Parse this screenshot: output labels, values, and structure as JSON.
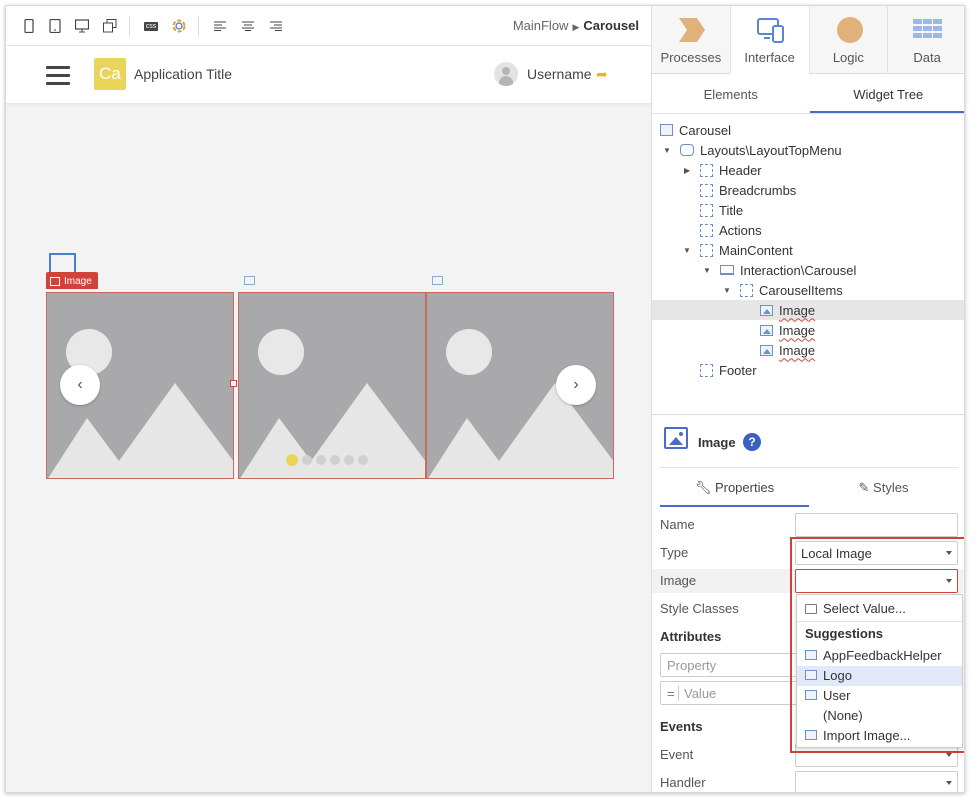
{
  "toolbar": {
    "breadcrumb_flow": "MainFlow",
    "breadcrumb_screen": "Carousel",
    "icons": [
      "phone-icon",
      "tablet-icon",
      "desktop-icon",
      "multi-device-icon",
      "css-icon",
      "theme-icon",
      "align-left-icon",
      "align-center-icon",
      "align-right-icon"
    ],
    "css_label": "css"
  },
  "app_header": {
    "logo_text": "Ca",
    "title": "Application Title",
    "username": "Username"
  },
  "canvas": {
    "image_tag": "Image",
    "carousel_slides": 3,
    "dots_count": 6,
    "active_dot": 1
  },
  "panel": {
    "top_tabs": [
      {
        "label": "Processes"
      },
      {
        "label": "Interface"
      },
      {
        "label": "Logic"
      },
      {
        "label": "Data"
      }
    ],
    "sub_tabs": [
      {
        "label": "Elements"
      },
      {
        "label": "Widget Tree"
      }
    ],
    "tree": [
      {
        "label": "Carousel"
      },
      {
        "label": "Layouts\\LayoutTopMenu"
      },
      {
        "label": "Header"
      },
      {
        "label": "Breadcrumbs"
      },
      {
        "label": "Title"
      },
      {
        "label": "Actions"
      },
      {
        "label": "MainContent"
      },
      {
        "label": "Interaction\\Carousel"
      },
      {
        "label": "CarouselItems"
      },
      {
        "label": "Image"
      },
      {
        "label": "Image"
      },
      {
        "label": "Image"
      },
      {
        "label": "Footer"
      }
    ],
    "properties": {
      "title": "Image",
      "help": "?",
      "tabs": [
        {
          "label": "Properties"
        },
        {
          "label": "Styles"
        }
      ],
      "name_label": "Name",
      "name_value": "",
      "type_label": "Type",
      "type_value": "Local Image",
      "image_label": "Image",
      "image_value": "",
      "style_classes_label": "Style Classes",
      "attributes_label": "Attributes",
      "property_placeholder": "Property",
      "value_placeholder": "Value",
      "eq": "=",
      "events_label": "Events",
      "event_label": "Event",
      "handler_label": "Handler"
    },
    "dropdown": {
      "select_value": "Select Value...",
      "suggestions_header": "Suggestions",
      "items": [
        {
          "label": "AppFeedbackHelper"
        },
        {
          "label": "Logo"
        },
        {
          "label": "User"
        },
        {
          "label": "(None)"
        },
        {
          "label": "Import Image..."
        }
      ]
    }
  }
}
